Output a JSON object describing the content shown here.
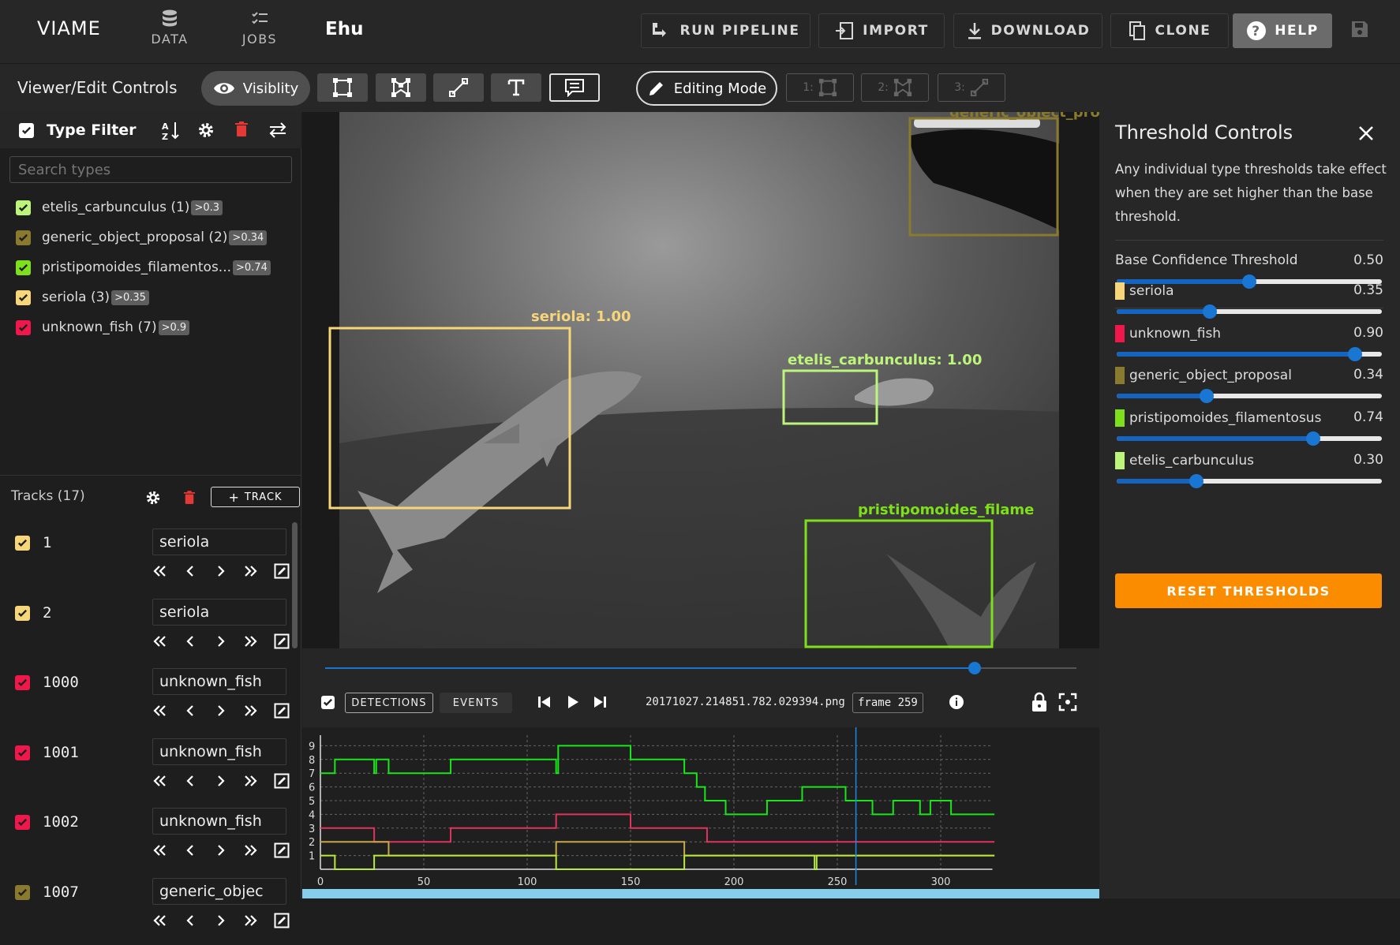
{
  "app": {
    "brand": "VIAME",
    "nav": [
      {
        "label": "DATA"
      },
      {
        "label": "JOBS"
      }
    ],
    "dataset_name": "Ehu"
  },
  "toolbar": {
    "run_pipeline": "RUN PIPELINE",
    "import": "IMPORT",
    "download": "DOWNLOAD",
    "clone": "CLONE",
    "help": "HELP"
  },
  "controls": {
    "title": "Viewer/Edit Controls",
    "visibility": "Visiblity",
    "editing_mode": "Editing Mode",
    "shortcuts": [
      "1:",
      "2:",
      "3:"
    ]
  },
  "type_filter": {
    "title": "Type Filter",
    "search_placeholder": "Search types",
    "types": [
      {
        "label": "etelis_carbunculus (1)",
        "badge": ">0.3",
        "color": "#bdf57a"
      },
      {
        "label": "generic_object_proposal (2)",
        "badge": ">0.34",
        "color": "#8a7a2e"
      },
      {
        "label": "pristipomoides_filamentos...",
        "badge": ">0.74",
        "color": "#7ee01a"
      },
      {
        "label": "seriola (3)",
        "badge": ">0.35",
        "color": "#f7d67a"
      },
      {
        "label": "unknown_fish (7)",
        "badge": ">0.9",
        "color": "#f0174a"
      }
    ]
  },
  "tracks": {
    "title": "Tracks (17)",
    "add_label": "TRACK",
    "items": [
      {
        "id": "1",
        "type": "seriola",
        "color": "#f7d67a"
      },
      {
        "id": "2",
        "type": "seriola",
        "color": "#f7d67a"
      },
      {
        "id": "1000",
        "type": "unknown_fish",
        "color": "#f0174a"
      },
      {
        "id": "1001",
        "type": "unknown_fish",
        "color": "#f0174a"
      },
      {
        "id": "1002",
        "type": "unknown_fish",
        "color": "#f0174a"
      },
      {
        "id": "1007",
        "type": "generic_objec",
        "color": "#8a7a2e"
      }
    ]
  },
  "viewer": {
    "detections": [
      {
        "label": "seriola: 1.00",
        "color": "#f7d67a"
      },
      {
        "label": "etelis_carbunculus: 1.00",
        "color": "#bdf57a"
      },
      {
        "label": "pristipomoides_filame",
        "color": "#7ee01a"
      },
      {
        "label": "generic_object_prop",
        "color": "#8a7a2e"
      }
    ]
  },
  "playback": {
    "detections_tab": "DETECTIONS",
    "events_tab": "EVENTS",
    "filename": "20171027.214851.782.029394.png",
    "frame": "frame 259",
    "progress": 0.865
  },
  "chart_data": {
    "type": "line",
    "xlim": [
      0,
      325
    ],
    "ylim": [
      0,
      9
    ],
    "x_ticks": [
      "0",
      "50",
      "100",
      "150",
      "200",
      "250",
      "300"
    ],
    "y_ticks": [
      "1",
      "2",
      "3",
      "4",
      "5",
      "6",
      "7",
      "8",
      "9"
    ],
    "current_frame": 259,
    "series": [
      {
        "color": "#19e619",
        "steps": [
          [
            0,
            7
          ],
          [
            7,
            8
          ],
          [
            26,
            7
          ],
          [
            27,
            8
          ],
          [
            33,
            7
          ],
          [
            63,
            8
          ],
          [
            114,
            7
          ],
          [
            115,
            9
          ],
          [
            150,
            8
          ],
          [
            176,
            7
          ],
          [
            182,
            6
          ],
          [
            186,
            5
          ],
          [
            196,
            4
          ],
          [
            216,
            5
          ],
          [
            233,
            6
          ],
          [
            254,
            5
          ],
          [
            267,
            4
          ],
          [
            277,
            5
          ],
          [
            290,
            4
          ],
          [
            295,
            5
          ],
          [
            305,
            4
          ],
          [
            326,
            4
          ]
        ]
      },
      {
        "color": "#e0345e",
        "steps": [
          [
            0,
            3
          ],
          [
            26,
            2
          ],
          [
            63,
            3
          ],
          [
            114,
            4
          ],
          [
            150,
            3
          ],
          [
            187,
            2
          ],
          [
            326,
            2
          ]
        ]
      },
      {
        "color": "#c9a84a",
        "steps": [
          [
            0,
            2
          ],
          [
            33,
            1
          ],
          [
            114,
            2
          ],
          [
            176,
            1
          ],
          [
            326,
            1
          ]
        ]
      },
      {
        "color": "#b7ea3c",
        "steps": [
          [
            0,
            1
          ],
          [
            7,
            0
          ],
          [
            26,
            1
          ],
          [
            114,
            0
          ],
          [
            176,
            1
          ],
          [
            239,
            0
          ],
          [
            240,
            1
          ],
          [
            326,
            1
          ]
        ]
      }
    ]
  },
  "thresholds": {
    "title": "Threshold Controls",
    "description": "Any individual type thresholds take effect when they are set higher than the base threshold.",
    "base": {
      "label": "Base Confidence Threshold",
      "value": "0.50",
      "fraction": 0.5
    },
    "types": [
      {
        "label": "seriola",
        "value": "0.35",
        "fraction": 0.35,
        "color": "#f7d67a"
      },
      {
        "label": "unknown_fish",
        "value": "0.90",
        "fraction": 0.9,
        "color": "#f0174a"
      },
      {
        "label": "generic_object_proposal",
        "value": "0.34",
        "fraction": 0.34,
        "color": "#8a7a2e"
      },
      {
        "label": "pristipomoides_filamentosus",
        "value": "0.74",
        "fraction": 0.74,
        "color": "#7ee01a"
      },
      {
        "label": "etelis_carbunculus",
        "value": "0.30",
        "fraction": 0.3,
        "color": "#bdf57a"
      }
    ],
    "reset_label": "RESET THRESHOLDS"
  }
}
